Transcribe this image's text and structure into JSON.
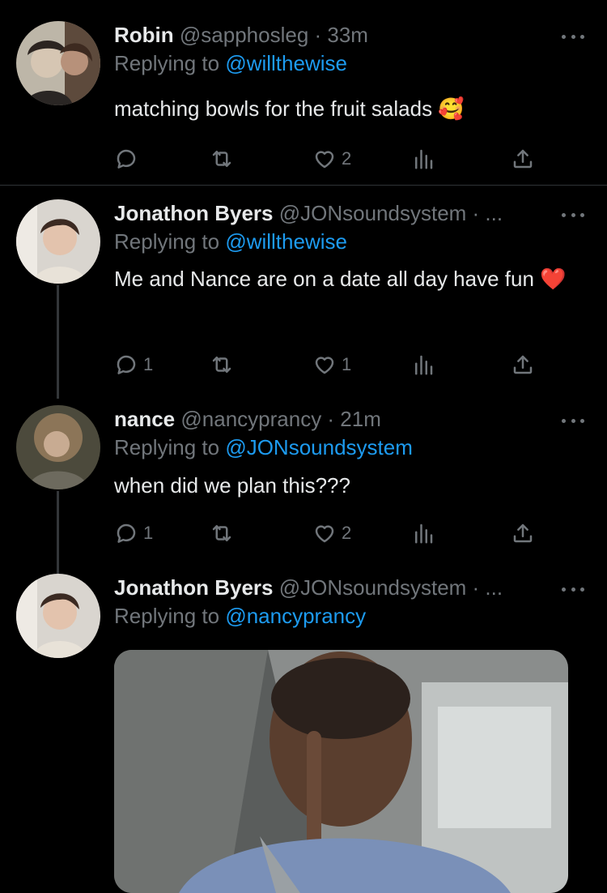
{
  "tweets": [
    {
      "name": "Robin",
      "handle": "@sapphosleg · 33m",
      "replying_prefix": "Replying to",
      "replying_to": "@willthewise",
      "text": "matching bowls for the fruit salads 🥰",
      "replies": "",
      "likes": "2"
    },
    {
      "name": "Jonathon Byers",
      "handle": "@JONsoundsystem · ...",
      "replying_prefix": "Replying to",
      "replying_to": "@willthewise",
      "text": "Me and Nance are on a date all day have fun ❤️",
      "replies": "1",
      "likes": "1"
    },
    {
      "name": "nance",
      "handle": "@nancyprancy · 21m",
      "replying_prefix": "Replying to",
      "replying_to": "@JONsoundsystem",
      "text": "when did we plan this???",
      "replies": "1",
      "likes": "2"
    },
    {
      "name": "Jonathon Byers",
      "handle": "@JONsoundsystem · ...",
      "replying_prefix": "Replying to",
      "replying_to": "@nancyprancy"
    }
  ],
  "icons": [
    "reply-icon",
    "retweet-icon",
    "like-icon",
    "analytics-icon",
    "share-icon",
    "more-icon"
  ],
  "colors": {
    "background": "#000000",
    "text": "#e7e9ea",
    "secondary": "#71767b",
    "link": "#1d9bf0",
    "divider": "#2f3336"
  }
}
